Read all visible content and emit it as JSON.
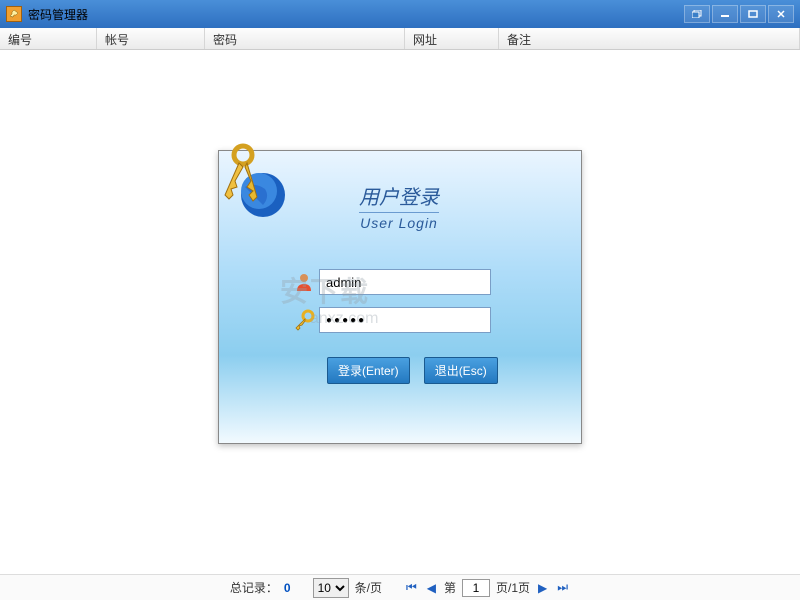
{
  "window": {
    "title": "密码管理器"
  },
  "columns": {
    "id": "编号",
    "account": "帐号",
    "password": "密码",
    "url": "网址",
    "remark": "备注"
  },
  "login": {
    "heading_cn": "用户登录",
    "heading_en": "User Login",
    "username_value": "admin",
    "password_value": "●●●●●",
    "login_button": "登录(Enter)",
    "exit_button": "退出(Esc)"
  },
  "watermark": {
    "main": "安下载",
    "sub": "anxz.com"
  },
  "pagination": {
    "total_label": "总记录：",
    "total_count": "0",
    "per_page_value": "10",
    "per_page_suffix": "条/页",
    "page_label_prefix": "第",
    "current_page": "1",
    "page_label_suffix": "页/1页"
  }
}
